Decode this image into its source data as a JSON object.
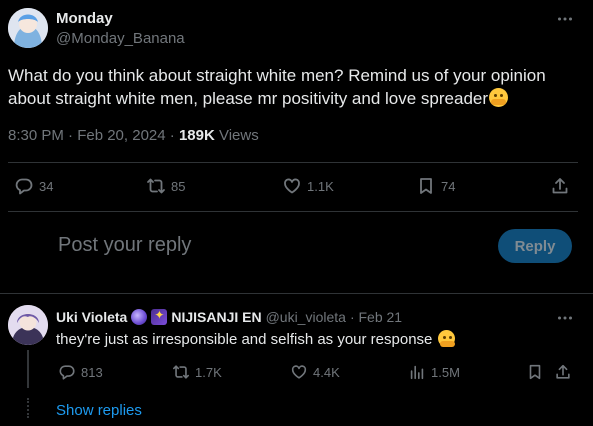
{
  "tweet": {
    "author_name": "Monday",
    "author_handle": "@Monday_Banana",
    "text": "What do you think about straight white men? Remind us of your opinion about straight white men, please mr positivity and love spreader",
    "time": "8:30 PM · Feb 20, 2024 · ",
    "views_count": "189K",
    "views_label": " Views",
    "actions": {
      "replies": "34",
      "retweets": "85",
      "likes": "1.1K",
      "bookmarks": "74"
    }
  },
  "composer": {
    "placeholder": "Post your reply",
    "button_label": "Reply"
  },
  "reply": {
    "author_name": "Uki Violeta",
    "affiliation": "NIJISANJI EN",
    "handle": "@uki_violeta",
    "date": "· Feb 21",
    "text": "they're just as irresponsible and selfish as your response",
    "actions": {
      "replies": "813",
      "retweets": "1.7K",
      "likes": "4.4K",
      "views": "1.5M"
    },
    "show_replies": "Show replies"
  },
  "colors": {
    "background": "#000000",
    "text": "#e7e9ea",
    "muted": "#71767b",
    "link": "#1d9bf0",
    "reply_button": "#0f4e78"
  },
  "icons": [
    "more-icon",
    "reply-icon",
    "retweet-icon",
    "like-icon",
    "bookmark-icon",
    "share-icon",
    "views-icon",
    "hug-emoji"
  ]
}
